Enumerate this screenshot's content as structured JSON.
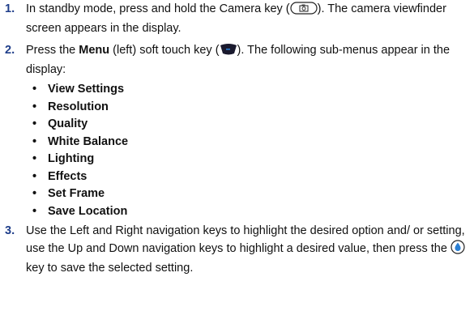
{
  "steps": [
    {
      "number": "1.",
      "text_before_icon": "In standby mode, press and hold the Camera key (",
      "icon_camera": "camera-key-icon",
      "text_after_icon": "). The camera viewfinder screen appears in the display."
    },
    {
      "number": "2.",
      "text_before_bold": "Press the ",
      "bold": "Menu",
      "text_mid": " (left) soft touch key (",
      "icon_softkey": "left-soft-key-icon",
      "text_after_icon": "). The following sub-menus appear in the display:",
      "submenus": [
        "View Settings",
        "Resolution",
        "Quality",
        "White Balance",
        "Lighting",
        "Effects",
        "Set Frame",
        "Save Location"
      ],
      "bullet": "•"
    },
    {
      "number": "3.",
      "text_before_icon": "Use the Left and Right navigation keys to highlight the desired option and/ or setting, use the Up and Down navigation keys to highlight a desired value, then press the ",
      "icon_ok": "ok-key-icon",
      "text_after_icon": " key to save the selected setting."
    }
  ],
  "colors": {
    "step_number": "#1f3e8a",
    "text": "#111111",
    "ok_key": "#2a7fd4"
  }
}
